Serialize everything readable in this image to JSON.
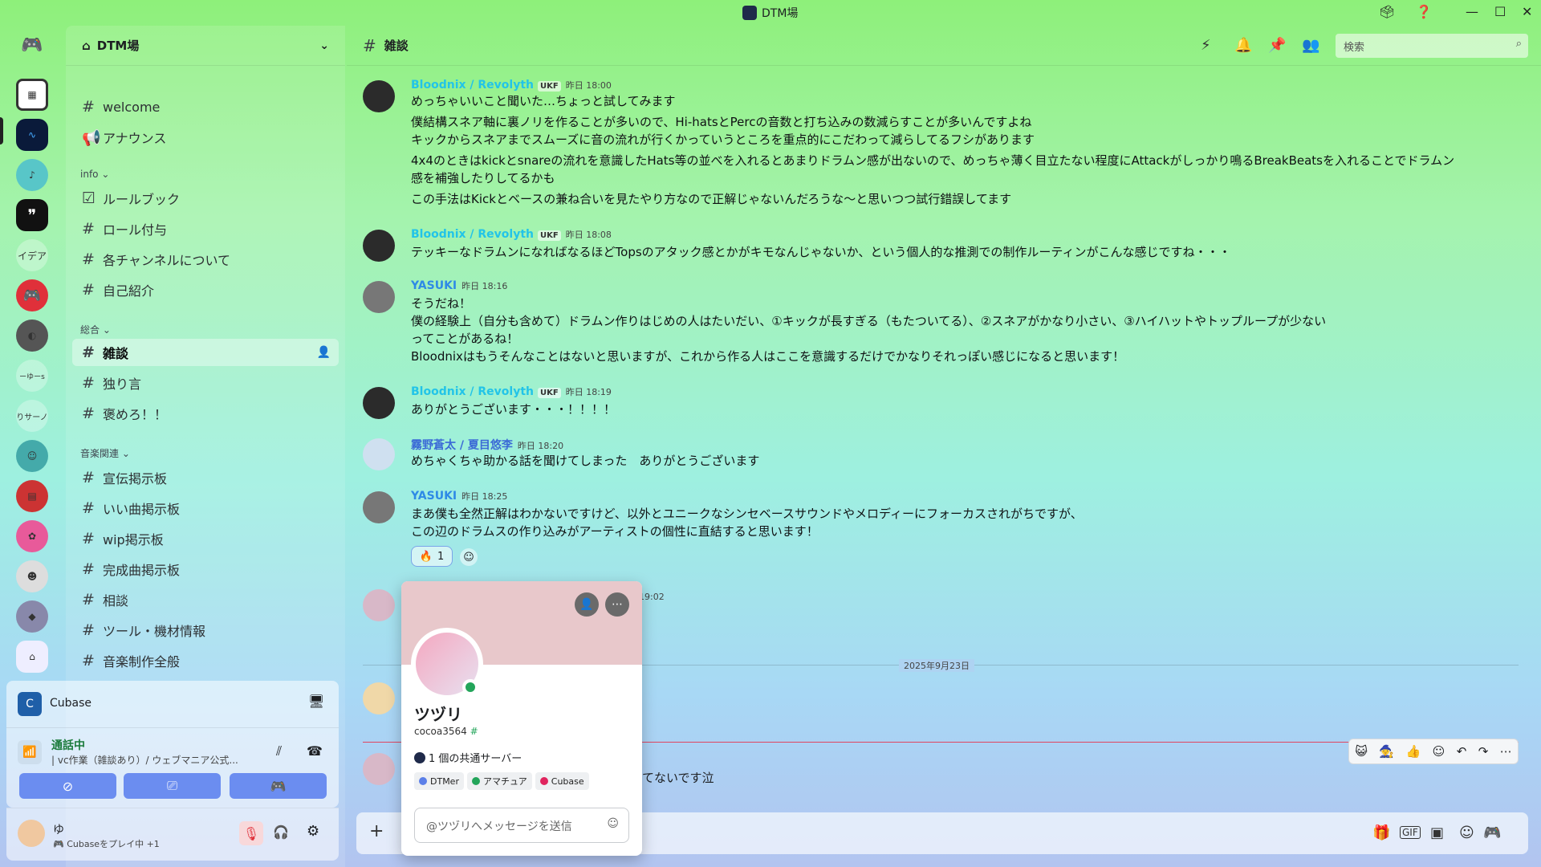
{
  "titlebar": {
    "title": "DTM場"
  },
  "server": {
    "name": "DTM場"
  },
  "server_rail": {
    "items": [
      {
        "name": "discord-home"
      },
      {
        "name": "qr-server"
      },
      {
        "name": "wave-server"
      },
      {
        "name": "anime-server"
      },
      {
        "name": "quote-server"
      },
      {
        "label": "イデア"
      },
      {
        "name": "discord-server"
      },
      {
        "name": "dark-server"
      },
      {
        "label": "ーゆーs"
      },
      {
        "label": "りサーノ"
      },
      {
        "name": "teal-server"
      },
      {
        "name": "poster-server"
      },
      {
        "name": "pink-server"
      },
      {
        "name": "girl-server"
      },
      {
        "name": "blue-server"
      },
      {
        "name": "building-server"
      }
    ]
  },
  "channels": {
    "top": [
      {
        "label": "welcome",
        "icon": "hash"
      },
      {
        "label": "アナウンス",
        "icon": "megaphone"
      }
    ],
    "info_label": "info",
    "info": [
      {
        "label": "ルールブック",
        "icon": "check"
      },
      {
        "label": "ロール付与",
        "icon": "hash"
      },
      {
        "label": "各チャンネルについて",
        "icon": "hash"
      },
      {
        "label": "自己紹介",
        "icon": "hash"
      }
    ],
    "general_label": "総合",
    "general": [
      {
        "label": "雑談",
        "icon": "hash",
        "active": true
      },
      {
        "label": "独り言",
        "icon": "hash"
      },
      {
        "label": "褒めろ！！",
        "icon": "hash"
      }
    ],
    "music_label": "音楽関連",
    "music": [
      {
        "label": "宣伝掲示板"
      },
      {
        "label": "いい曲掲示板"
      },
      {
        "label": "wip掲示板"
      },
      {
        "label": "完成曲掲示板"
      },
      {
        "label": "相談"
      },
      {
        "label": "ツール・機材情報"
      },
      {
        "label": "音楽制作全般"
      }
    ]
  },
  "voice": {
    "app": "Cubase",
    "status": "通話中",
    "channel": "| vc作業（雑談あり）/ ウェブマニア公式..."
  },
  "user": {
    "name": "ゆ",
    "activity": "Cubaseをプレイ中 +1"
  },
  "chat": {
    "channel": "雑談",
    "search_placeholder": "検索"
  },
  "messages": [
    {
      "author": "Bloodnix / Revolyth",
      "tag": "UKF",
      "time": "昨日 18:00",
      "lines": [
        "めっちゃいいこと聞いた…ちょっと試してみます",
        "僕結構スネア軸に裏ノリを作ることが多いので、Hi-hatsとPercの音数と打ち込みの数減らすことが多いんですよね",
        "キックからスネアまでスムーズに音の流れが行くかっていうところを重点的にこだわって減らしてるフシがあります",
        "4x4のときはkickとsnareの流れを意識したHats等の並べを入れるとあまりドラムン感が出ないので、めっちゃ薄く目立たない程度にAttackがしっかり鳴るBreakBeatsを入れることでドラムン",
        "感を補強したりしてるかも",
        "この手法はKickとベースの兼ね合いを見たやり方なので正解じゃないんだろうな～と思いつつ試行錯誤してます"
      ]
    },
    {
      "author": "Bloodnix / Revolyth",
      "tag": "UKF",
      "time": "昨日 18:08",
      "lines": [
        "テッキーなドラムンになればなるほどTopsのアタック感とかがキモなんじゃないか、という個人的な推測での制作ルーティンがこんな感じですね・・・"
      ]
    },
    {
      "author": "YASUKI",
      "time": "昨日 18:16",
      "lines": [
        "そうだね！",
        "僕の経験上（自分も含めて）ドラムン作りはじめの人はたいだい、①キックが長すぎる（もたついてる）、②スネアがかなり小さい、③ハイハットやトップループが少ない",
        "ってことがあるね！",
        "Bloodnixはもうそんなことはないと思いますが、これから作る人はここを意識するだけでかなりそれっぽい感じになると思います！"
      ]
    },
    {
      "author": "Bloodnix / Revolyth",
      "tag": "UKF",
      "time": "昨日 18:19",
      "lines": [
        "ありがとうございます・・・！！！！"
      ]
    },
    {
      "author": "霧野蒼太 / 夏目悠李",
      "time": "昨日 18:20",
      "lines": [
        "めちゃくちゃ助かる話を聞けてしまった　ありがとうございます"
      ]
    },
    {
      "author": "YASUKI",
      "time": "昨日 18:25",
      "lines": [
        "まあ僕も全然正解はわかないですけど、以外とユニークなシンセベースサウンドやメロディーにフォーカスされがちですが、",
        "この辺のドラムスの作り込みがアーティストの個性に直結すると思います！"
      ]
    }
  ],
  "reaction": {
    "emoji": "🔥",
    "count": "1"
  },
  "partial_time": "19:02",
  "date_divider": "2025年9月23日",
  "partial_message": "てないです泣",
  "profile": {
    "display_name": "ツヅリ",
    "username": "cocoa3564",
    "mutual": "1 個の共通サーバー",
    "roles": [
      {
        "label": "DTMer",
        "color": "#5b7fe8"
      },
      {
        "label": "アマチュア",
        "color": "#23a55a"
      },
      {
        "label": "Cubase",
        "color": "#e0245e"
      }
    ],
    "message_placeholder": "@ツヅリへメッセージを送信"
  },
  "colors": {
    "accent": "#5865f2",
    "online": "#23a55a",
    "author_blood": "#22c4e8",
    "author_yasuki": "#2e8ae6"
  }
}
